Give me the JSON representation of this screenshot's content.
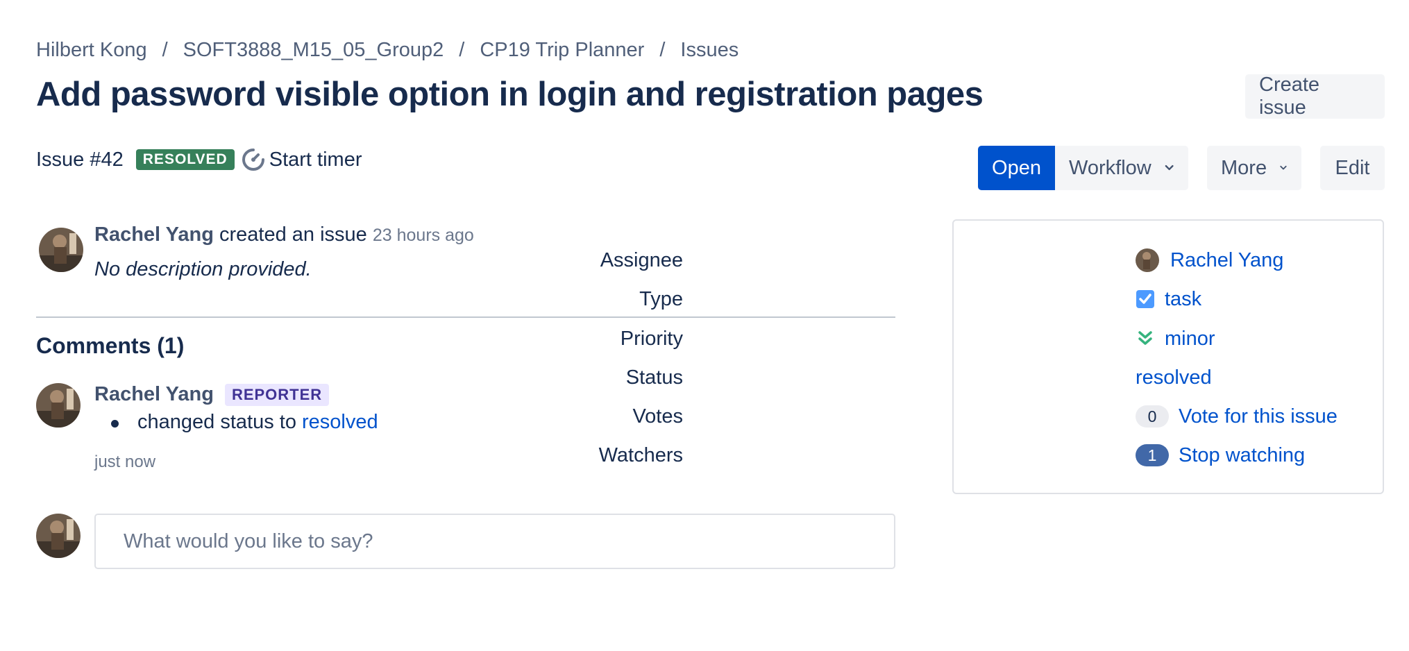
{
  "breadcrumb": [
    "Hilbert Kong",
    "SOFT3888_M15_05_Group2",
    "CP19 Trip Planner",
    "Issues"
  ],
  "breadcrumb_separator": "/",
  "title": "Add password visible option in login and registration pages",
  "create_issue_label": "Create issue",
  "issue": {
    "number": "Issue #42",
    "status_badge": "RESOLVED",
    "timer_label": "Start timer"
  },
  "actions": {
    "open": "Open",
    "workflow": "Workflow",
    "more": "More",
    "edit": "Edit"
  },
  "activity": {
    "author": "Rachel Yang",
    "action": "created an issue",
    "time": "23 hours ago",
    "description": "No description provided."
  },
  "comments": {
    "title": "Comments (1)",
    "items": [
      {
        "author": "Rachel Yang",
        "role_badge": "REPORTER",
        "change_text": "changed status to",
        "change_value": "resolved",
        "time": "just now"
      }
    ],
    "input_placeholder": "What would you like to say?"
  },
  "details": {
    "assignee": {
      "label": "Assignee",
      "value": "Rachel Yang"
    },
    "type": {
      "label": "Type",
      "value": "task",
      "icon": "checkbox-icon"
    },
    "priority": {
      "label": "Priority",
      "value": "minor",
      "icon": "double-chevron-down-icon"
    },
    "status": {
      "label": "Status",
      "value": "resolved"
    },
    "votes": {
      "label": "Votes",
      "count": "0",
      "action": "Vote for this issue"
    },
    "watchers": {
      "label": "Watchers",
      "count": "1",
      "action": "Stop watching"
    }
  },
  "colors": {
    "primary": "#0052cc",
    "resolved_badge": "#36805a",
    "reporter_badge_bg": "#eae6ff",
    "reporter_badge_text": "#403294",
    "priority_minor": "#36b37e"
  }
}
